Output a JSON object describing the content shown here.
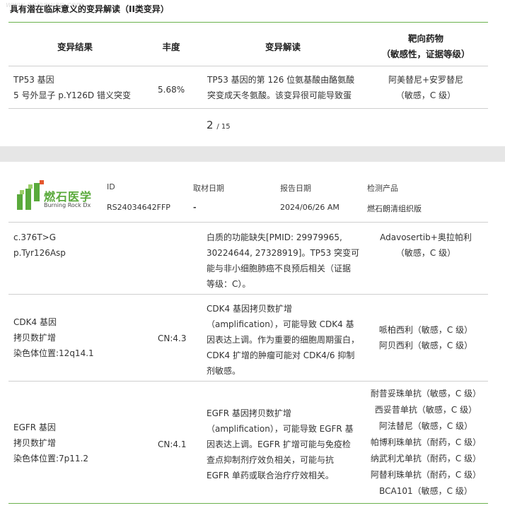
{
  "top": {
    "section_title": "具有潜在临床意义的变异解读（II类变异）",
    "headers": {
      "result": "变异结果",
      "abundance": "丰度",
      "interpretation": "变异解读",
      "drug_line1": "靶向药物",
      "drug_line2": "（敏感性，证据等级）"
    },
    "row": {
      "gene": "TP53 基因",
      "detail": "5 号外显子 p.Y126D 错义突变",
      "abundance": "5.68%",
      "interp_l1": "TP53 基因的第 126 位氨基酸由酪氨酸",
      "interp_l2": "突变成天冬氨酸。该变异很可能导致蛋",
      "drug_l1": "阿美替尼+安罗替尼",
      "drug_l2": "（敏感，C 级）"
    },
    "page_current": "2",
    "page_total": "/ 15",
    "watermark": "www.aqianwan.com"
  },
  "header": {
    "logo_cn": "燃石医学",
    "logo_en": "Burning Rock Dx",
    "labels": {
      "id": "ID",
      "sample_date": "取材日期",
      "report_date": "报告日期",
      "product": "检测产品"
    },
    "values": {
      "id": "RS24034642FFP",
      "sample_date": "-",
      "report_date": "2024/06/26 AM",
      "product": "燃石朗清组织版"
    }
  },
  "rows": [
    {
      "left": [
        "c.376T>G",
        "p.Tyr126Asp"
      ],
      "cn": "",
      "interp": [
        "白质的功能缺失[PMID: 29979965,",
        "30224644, 27328919]。TP53 突变可",
        "能与非小细胞肺癌不良预后相关（证据",
        "等级：C）。"
      ],
      "drugs": [
        "Adavosertib+奥拉帕利",
        "（敏感，C 级）"
      ]
    },
    {
      "left": [
        "CDK4 基因",
        "拷贝数扩增",
        "染色体位置:12q14.1"
      ],
      "cn": "CN:4.3",
      "interp": [
        "CDK4 基因拷贝数扩增",
        "（amplification），可能导致 CDK4 基",
        "因表达上调。作为重要的细胞周期蛋白，",
        "CDK4 扩增的肿瘤可能对 CDK4/6 抑制",
        "剂敏感。"
      ],
      "drugs": [
        "哌柏西利（敏感，C 级）",
        "阿贝西利（敏感，C 级）"
      ]
    },
    {
      "left": [
        "EGFR 基因",
        "拷贝数扩增",
        "染色体位置:7p11.2"
      ],
      "cn": "CN:4.1",
      "interp": [
        "EGFR 基因拷贝数扩增",
        "（amplification），可能导致 EGFR 基",
        "因表达上调。EGFR 扩增可能与免疫检",
        "查点抑制剂疗效负相关，可能与抗",
        "EGFR 单药或联合治疗疗效相关。"
      ],
      "drugs": [
        "耐昔妥珠单抗（敏感，C 级）",
        "西妥昔单抗（敏感，C 级）",
        "阿法替尼（敏感，C 级）",
        "帕博利珠单抗（耐药，C 级）",
        "纳武利尤单抗（耐药，C 级）",
        "阿替利珠单抗（耐药，C 级）",
        "BCA101（敏感，C 级）"
      ]
    }
  ],
  "colors": {
    "brand_green": "#6bb24d",
    "logo_green": "#5aaa3c",
    "logo_dark": "#4a4a4a"
  }
}
